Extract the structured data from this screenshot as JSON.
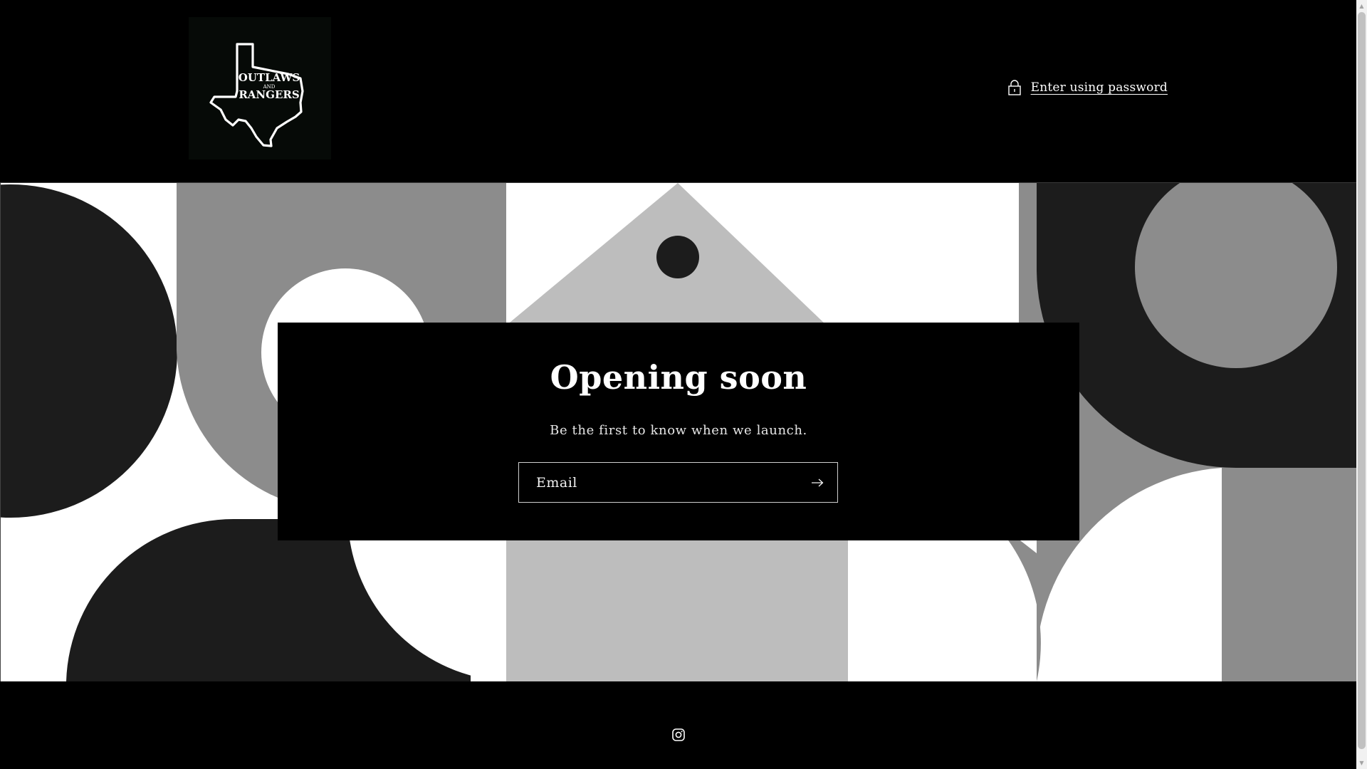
{
  "header": {
    "logo": {
      "line1": "OUTLAWS",
      "line2": "AND",
      "line3": "RANGERS",
      "icon": "texas-map-logo"
    },
    "password_link": {
      "label": "Enter using password",
      "icon": "lock-icon"
    }
  },
  "card": {
    "title": "Opening soon",
    "subtitle": "Be the first to know when we launch.",
    "email_placeholder": "Email",
    "submit_icon": "arrow-right-icon"
  },
  "footer": {
    "social_icon": "instagram-icon"
  },
  "colors": {
    "background": "#000000",
    "text": "#ffffff",
    "banner_dark": "#1c1c1c",
    "banner_mid": "#8c8c8c",
    "banner_light": "#bdbdbd",
    "banner_white": "#ffffff"
  }
}
